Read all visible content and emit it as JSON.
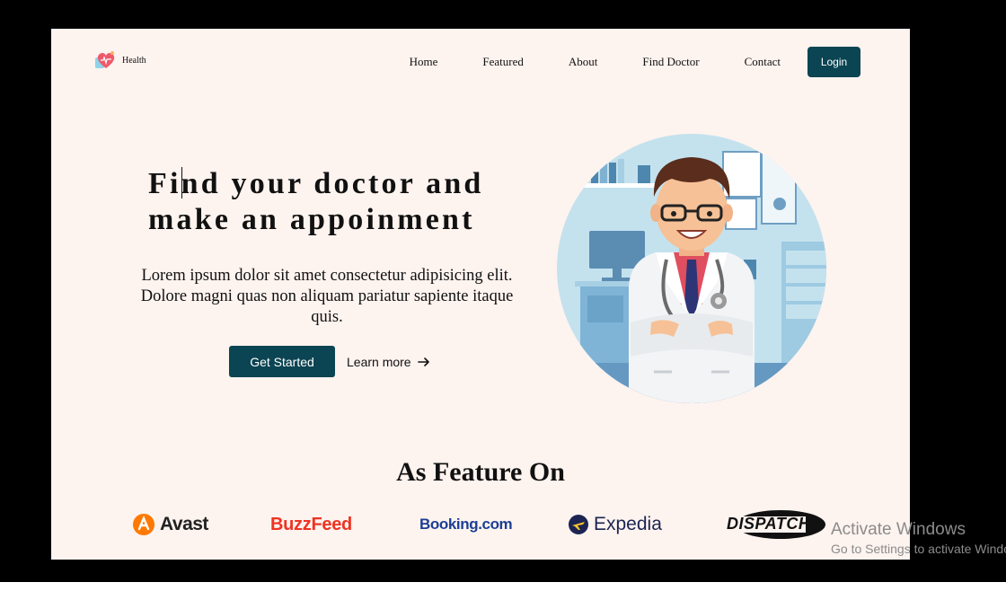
{
  "logo": {
    "text": "Health"
  },
  "nav": {
    "links": [
      "Home",
      "Featured",
      "About",
      "Find Doctor",
      "Contact"
    ],
    "login": "Login"
  },
  "hero": {
    "title_line1": "Find your doctor and",
    "title_line2": "make an appoinment",
    "description": "Lorem ipsum dolor sit amet consectetur adipisicing elit. Dolore magni quas non aliquam pariatur sapiente itaque quis.",
    "cta_primary": "Get Started",
    "cta_secondary": "Learn more"
  },
  "feature": {
    "title": "As Feature On",
    "brands": [
      "Avast",
      "BuzzFeed",
      "Booking.com",
      "Expedia",
      "DISPATCH"
    ]
  },
  "watermark": {
    "title": "Activate Windows",
    "subtitle": "Go to Settings to activate Windows."
  },
  "colors": {
    "accent": "#0b4452",
    "background": "#fdf3ef",
    "avast": "#ff7800",
    "buzzfeed": "#ee3322",
    "booking": "#1c3f94",
    "expedia": "#1c2451"
  }
}
